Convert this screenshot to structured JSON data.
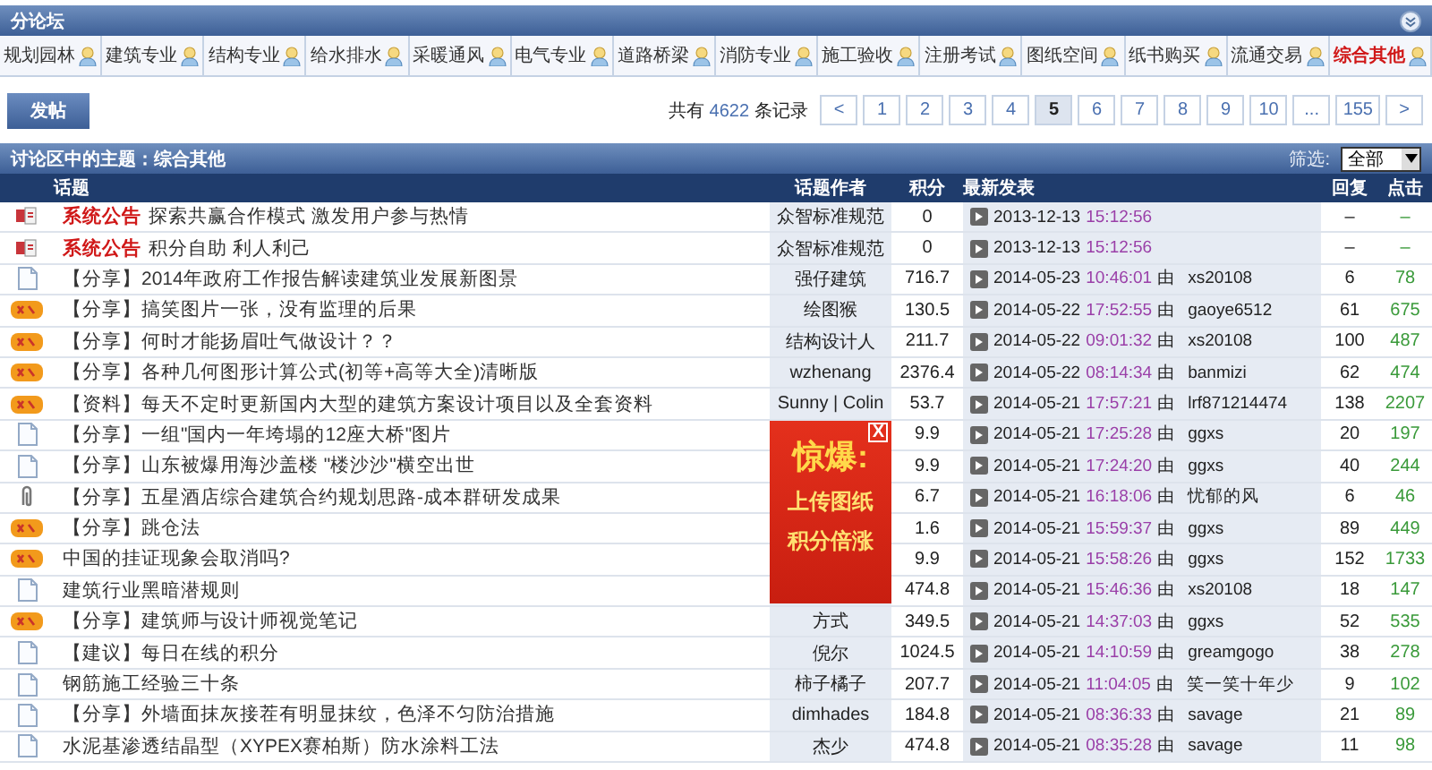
{
  "subforums": {
    "title": "分论坛",
    "tabs": [
      {
        "label": "规划园林",
        "selected": false
      },
      {
        "label": "建筑专业",
        "selected": false
      },
      {
        "label": "结构专业",
        "selected": false
      },
      {
        "label": "给水排水",
        "selected": false
      },
      {
        "label": "采暖通风",
        "selected": false
      },
      {
        "label": "电气专业",
        "selected": false
      },
      {
        "label": "道路桥梁",
        "selected": false
      },
      {
        "label": "消防专业",
        "selected": false
      },
      {
        "label": "施工验收",
        "selected": false
      },
      {
        "label": "注册考试",
        "selected": false
      },
      {
        "label": "图纸空间",
        "selected": false
      },
      {
        "label": "纸书购买",
        "selected": false
      },
      {
        "label": "流通交易",
        "selected": false
      },
      {
        "label": "综合其他",
        "selected": true
      }
    ]
  },
  "post_button": "发帖",
  "pagination": {
    "prefix": "共有",
    "count": "4622",
    "suffix": "条记录",
    "pages": [
      {
        "label": "<",
        "selected": false
      },
      {
        "label": "1",
        "selected": false
      },
      {
        "label": "2",
        "selected": false
      },
      {
        "label": "3",
        "selected": false
      },
      {
        "label": "4",
        "selected": false
      },
      {
        "label": "5",
        "selected": true
      },
      {
        "label": "6",
        "selected": false
      },
      {
        "label": "7",
        "selected": false
      },
      {
        "label": "8",
        "selected": false
      },
      {
        "label": "9",
        "selected": false
      },
      {
        "label": "10",
        "selected": false
      },
      {
        "label": "...",
        "selected": false
      },
      {
        "label": "155",
        "selected": false
      },
      {
        "label": ">",
        "selected": false
      }
    ]
  },
  "topics": {
    "title": "讨论区中的主题：综合其他",
    "filter_label": "筛选:",
    "filter_value": "全部",
    "columns": [
      "话题",
      "话题作者",
      "积分",
      "最新发表",
      "回复",
      "点击"
    ],
    "rows": [
      {
        "kind": "announce",
        "tag": "系统公告",
        "title": "探索共赢合作模式 激发用户参与热情",
        "author": "众智标准规范",
        "score": "0",
        "date": "2013-12-13",
        "time": "15:12:56",
        "replies": "–",
        "clicks": "–"
      },
      {
        "kind": "announce",
        "tag": "系统公告",
        "title": "积分自助 利人利己",
        "author": "众智标准规范",
        "score": "0",
        "date": "2013-12-13",
        "time": "15:12:56",
        "replies": "–",
        "clicks": "–"
      },
      {
        "kind": "normal",
        "title": "【分享】2014年政府工作报告解读建筑业发展新图景",
        "author": "强仔建筑",
        "score": "716.7",
        "date": "2014-05-23",
        "time": "10:46:01",
        "by": "由",
        "last_user": "xs20108",
        "replies": "6",
        "clicks": "78"
      },
      {
        "kind": "hot",
        "title": "【分享】搞笑图片一张，没有监理的后果",
        "author": "绘图猴",
        "score": "130.5",
        "date": "2014-05-22",
        "time": "17:52:55",
        "by": "由",
        "last_user": "gaoye6512",
        "replies": "61",
        "clicks": "675"
      },
      {
        "kind": "hot",
        "title": "【分享】何时才能扬眉吐气做设计？？",
        "author": "结构设计人",
        "score": "211.7",
        "date": "2014-05-22",
        "time": "09:01:32",
        "by": "由",
        "last_user": "xs20108",
        "replies": "100",
        "clicks": "487"
      },
      {
        "kind": "hot",
        "title": "【分享】各种几何图形计算公式(初等+高等大全)清晰版",
        "author": "wzhenang",
        "score": "2376.4",
        "date": "2014-05-22",
        "time": "08:14:34",
        "by": "由",
        "last_user": "banmizi",
        "replies": "62",
        "clicks": "474"
      },
      {
        "kind": "hot",
        "title": "【资料】每天不定时更新国内大型的建筑方案设计项目以及全套资料",
        "author": "Sunny | Colin",
        "score": "53.7",
        "date": "2014-05-21",
        "time": "17:57:21",
        "by": "由",
        "last_user": "lrf871214474",
        "replies": "138",
        "clicks": "2207"
      },
      {
        "kind": "normal",
        "title": "【分享】一组\"国内一年垮塌的12座大桥\"图片",
        "score": "9.9",
        "date": "2014-05-21",
        "time": "17:25:28",
        "by": "由",
        "last_user": "ggxs",
        "replies": "20",
        "clicks": "197"
      },
      {
        "kind": "normal",
        "title": "【分享】山东被爆用海沙盖楼 \"楼沙沙\"横空出世",
        "score": "9.9",
        "date": "2014-05-21",
        "time": "17:24:20",
        "by": "由",
        "last_user": "ggxs",
        "replies": "40",
        "clicks": "244"
      },
      {
        "kind": "attach",
        "title": "【分享】五星酒店综合建筑合约规划思路-成本群研发成果",
        "score": "6.7",
        "date": "2014-05-21",
        "time": "16:18:06",
        "by": "由",
        "last_user": "忧郁的风",
        "replies": "6",
        "clicks": "46"
      },
      {
        "kind": "hot",
        "title": "【分享】跳仓法",
        "score": "1.6",
        "date": "2014-05-21",
        "time": "15:59:37",
        "by": "由",
        "last_user": "ggxs",
        "replies": "89",
        "clicks": "449"
      },
      {
        "kind": "hot",
        "title": "中国的挂证现象会取消吗?",
        "score": "9.9",
        "date": "2014-05-21",
        "time": "15:58:26",
        "by": "由",
        "last_user": "ggxs",
        "replies": "152",
        "clicks": "1733"
      },
      {
        "kind": "normal",
        "title": "建筑行业黑暗潜规则",
        "score": "474.8",
        "date": "2014-05-21",
        "time": "15:46:36",
        "by": "由",
        "last_user": "xs20108",
        "replies": "18",
        "clicks": "147"
      },
      {
        "kind": "hot",
        "title": "【分享】建筑师与设计师视觉笔记",
        "author": "方式",
        "score": "349.5",
        "date": "2014-05-21",
        "time": "14:37:03",
        "by": "由",
        "last_user": "ggxs",
        "replies": "52",
        "clicks": "535"
      },
      {
        "kind": "normal",
        "title": "【建议】每日在线的积分",
        "author": "倪尔",
        "score": "1024.5",
        "date": "2014-05-21",
        "time": "14:10:59",
        "by": "由",
        "last_user": "greamgogo",
        "replies": "38",
        "clicks": "278"
      },
      {
        "kind": "normal",
        "title": "钢筋施工经验三十条",
        "author": "柿子橘子",
        "score": "207.7",
        "date": "2014-05-21",
        "time": "11:04:05",
        "by": "由",
        "last_user": "笑一笑十年少",
        "replies": "9",
        "clicks": "102"
      },
      {
        "kind": "normal",
        "title": "【分享】外墙面抹灰接茬有明显抹纹，色泽不匀防治措施",
        "author": "dimhades",
        "score": "184.8",
        "date": "2014-05-21",
        "time": "08:36:33",
        "by": "由",
        "last_user": "savage",
        "replies": "21",
        "clicks": "89"
      },
      {
        "kind": "normal",
        "title": "水泥基渗透结晶型（XYPEX赛柏斯）防水涂料工法",
        "author": "杰少",
        "score": "474.8",
        "date": "2014-05-21",
        "time": "08:35:28",
        "by": "由",
        "last_user": "savage",
        "replies": "11",
        "clicks": "98"
      }
    ]
  },
  "ad_popup": {
    "close": "X",
    "headline": "惊爆:",
    "lines": [
      "上传图纸",
      "积分倍涨"
    ]
  }
}
